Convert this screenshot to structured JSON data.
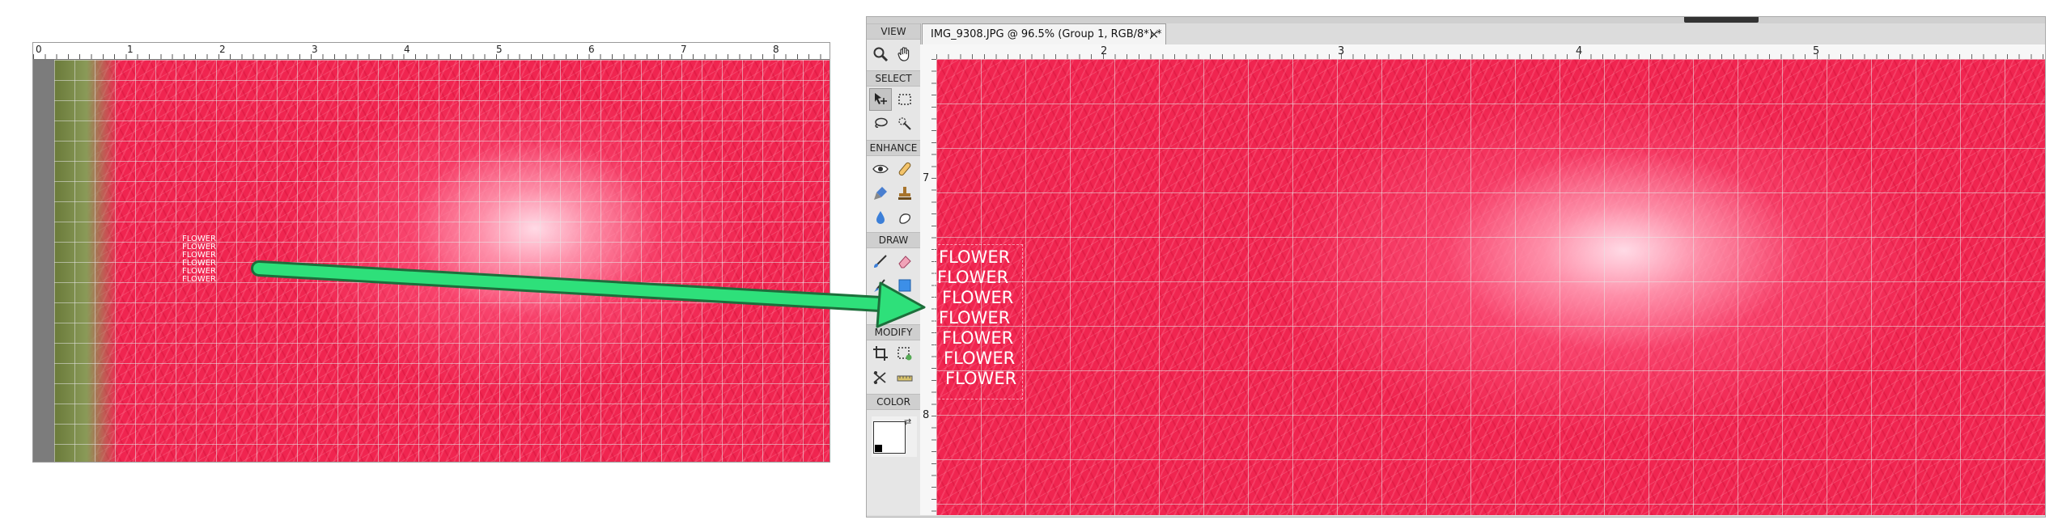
{
  "left_image": {
    "ruler_labels": [
      "0",
      "1",
      "2",
      "3",
      "4",
      "5",
      "6",
      "7",
      "8"
    ],
    "overlay_text": [
      "FLOWER",
      "FLOWER",
      "FLOWER",
      "FLOWER",
      "FLOWER",
      "FLOWER"
    ]
  },
  "editor": {
    "toolbox": {
      "sections": {
        "view": "VIEW",
        "select": "SELECT",
        "enhance": "ENHANCE",
        "draw": "DRAW",
        "modify": "MODIFY",
        "color": "COLOR"
      },
      "tools": {
        "zoom": "zoom-icon",
        "hand": "hand-icon",
        "move": "move-icon",
        "marquee": "marquee-icon",
        "lasso": "lasso-icon",
        "quick_select": "quick-selection-icon",
        "red_eye": "red-eye-icon",
        "spot_heal": "spot-healing-brush-icon",
        "smart_brush": "smart-brush-icon",
        "clone_stamp": "clone-stamp-icon",
        "blur": "blur-icon",
        "sponge": "sponge-icon",
        "brush": "brush-icon",
        "eraser": "eraser-icon",
        "paint_bucket": "paint-bucket-icon",
        "shape": "shape-icon",
        "type": "type-icon",
        "pencil": "pencil-icon",
        "crop": "crop-icon",
        "recompose": "recompose-icon",
        "content_move": "content-aware-move-icon",
        "straighten": "straighten-icon"
      },
      "colors": {
        "foreground": "#ffffff",
        "background": "#ffffff"
      }
    },
    "document_tab": {
      "title": "IMG_9308.JPG @ 96.5% (Group 1, RGB/8*) *",
      "close": "×"
    },
    "top_ruler_labels": [
      "2",
      "3",
      "4",
      "5"
    ],
    "side_ruler_labels": [
      "7",
      "8"
    ],
    "overlay_text": [
      "FLOWER",
      "FLOWER",
      "FLOWER",
      "FLOWER",
      "FLOWER",
      "FLOWER",
      "FLOWER"
    ]
  },
  "annotation": {
    "arrow_color": "#2ee07a"
  }
}
